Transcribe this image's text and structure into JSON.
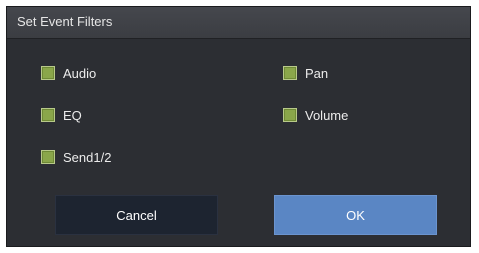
{
  "dialog": {
    "title": "Set Event Filters"
  },
  "filters": {
    "audio": {
      "label": "Audio",
      "checked": true
    },
    "pan": {
      "label": "Pan",
      "checked": true
    },
    "eq": {
      "label": "EQ",
      "checked": true
    },
    "volume": {
      "label": "Volume",
      "checked": true
    },
    "send": {
      "label": "Send1/2",
      "checked": true
    }
  },
  "buttons": {
    "cancel_label": "Cancel",
    "ok_label": "OK"
  },
  "colors": {
    "checkbox_checked": "#8aa64a",
    "ok_button": "#5a86c4",
    "cancel_button": "#1d2430",
    "dialog_bg": "#2c2e33"
  }
}
